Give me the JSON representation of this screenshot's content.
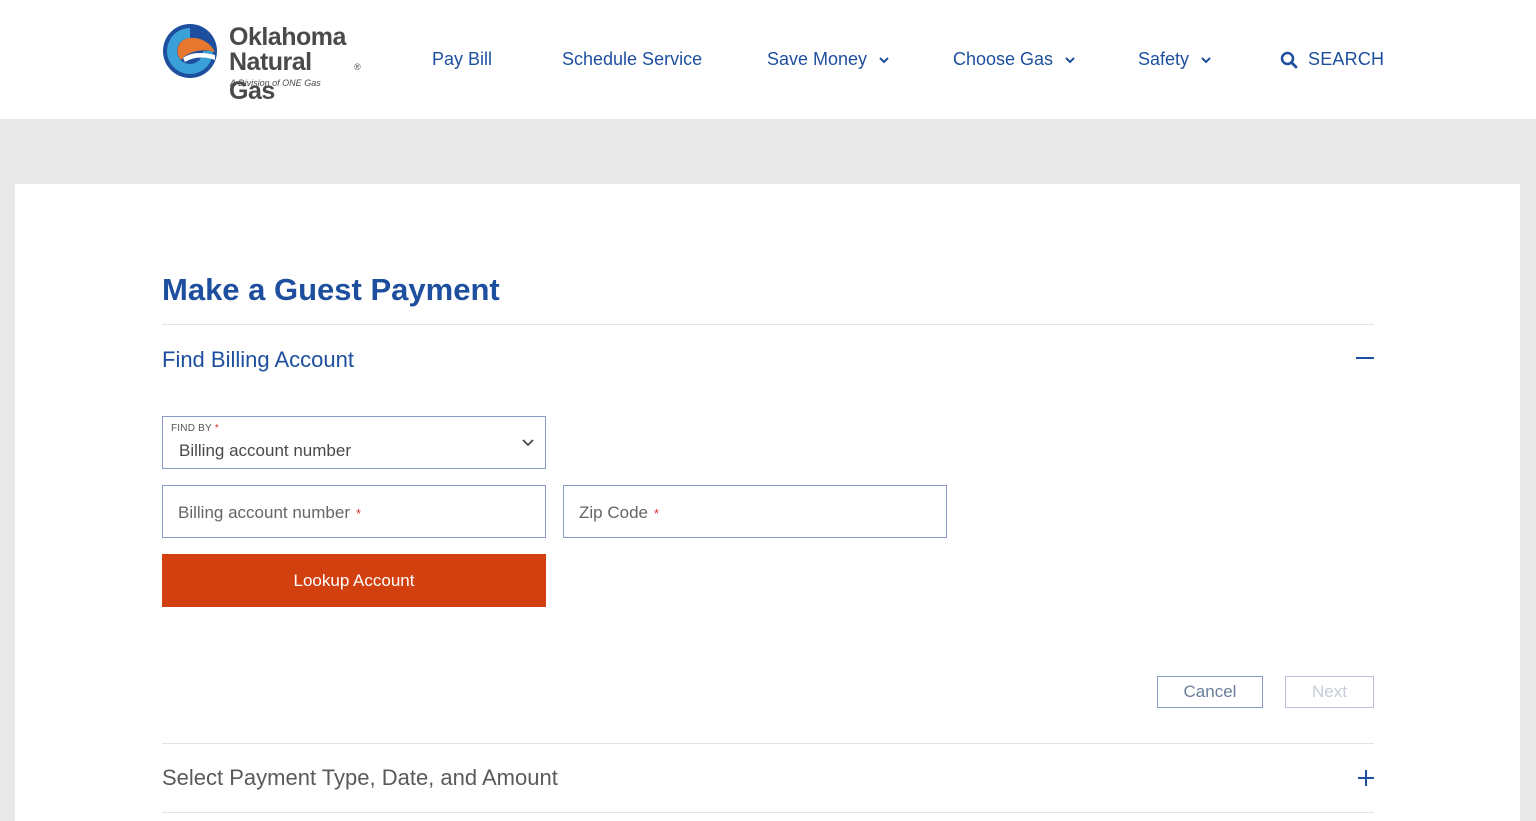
{
  "brand": {
    "line1": "Oklahoma",
    "line2": "Natural Gas",
    "registered": "®",
    "subline": "A Division of ONE Gas",
    "colors": {
      "blue": "#1d4f9e",
      "orange": "#e8772e",
      "teal": "#3aa0d8"
    }
  },
  "nav": {
    "pay_bill": "Pay Bill",
    "schedule_service": "Schedule Service",
    "save_money": "Save Money",
    "choose_gas": "Choose Gas",
    "safety": "Safety",
    "search": "SEARCH"
  },
  "page": {
    "title": "Make a Guest Payment"
  },
  "find_account": {
    "title": "Find Billing Account",
    "find_by_label": "FIND BY",
    "required_mark": "*",
    "find_by_value": "Billing account number",
    "billing_placeholder": "Billing account number",
    "zip_placeholder": "Zip Code",
    "lookup_button": "Lookup Account"
  },
  "actions": {
    "cancel": "Cancel",
    "next": "Next"
  },
  "payment_section": {
    "title": "Select Payment Type, Date, and Amount"
  },
  "colors": {
    "accent_blue": "#1d4f9e",
    "lookup_orange": "#d2400f",
    "required_red": "#d9342b",
    "page_bg": "#e9e9e9"
  }
}
